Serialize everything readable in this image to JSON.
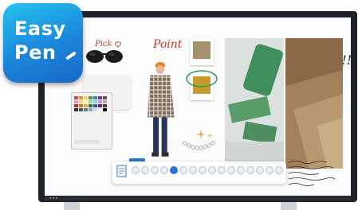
{
  "app_icon": {
    "line1": "Easy",
    "line2": "Pen",
    "colors": {
      "top": "#23c3ee",
      "bottom": "#1a67c8",
      "text": "#ffffff"
    }
  },
  "canvas": {
    "annotations": {
      "pick": "Pick",
      "point": "Point",
      "good": "Good!!"
    },
    "palette_colors": [
      "#e53935",
      "#fb8c00",
      "#fdd835",
      "#43a047",
      "#1e88e5",
      "#8e24aa",
      "#6d4c41",
      "#ef9a9a",
      "#ffcc80",
      "#fff59d",
      "#a5d6a7",
      "#90caf9",
      "#ce93d8",
      "#bcaaa4",
      "#c62828",
      "#ef6c00",
      "#f9a825",
      "#2e7d32",
      "#1565c0",
      "#6a1b9a",
      "#4e342e",
      "#263238",
      "#455a64",
      "#607d8b",
      "#90a4ae",
      "#cfd8dc",
      "#eceff1",
      "#000000"
    ],
    "swatches": [
      {
        "color": "#a5926a"
      },
      {
        "color": "#c79a2a"
      }
    ]
  },
  "toolbar": {
    "items": [
      "",
      "",
      "",
      "",
      "",
      "",
      "",
      "",
      "",
      "",
      "",
      "",
      "",
      "",
      "",
      ""
    ],
    "active_index": 4
  }
}
